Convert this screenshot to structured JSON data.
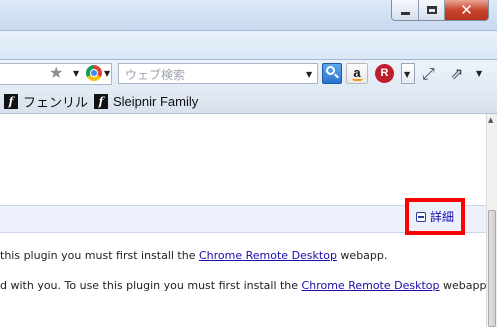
{
  "search": {
    "placeholder": "ウェブ検索"
  },
  "toolbar": {
    "amazon_label": "a",
    "rakuten_label": "R"
  },
  "bookmarks": [
    {
      "icon": "sleipnir-logo-icon",
      "label": "フェンリル"
    },
    {
      "icon": "sleipnir-logo-icon",
      "label": "Sleipnir Family"
    }
  ],
  "plugin": {
    "details_label": "詳細",
    "line1": {
      "before": "this plugin you must first install the ",
      "link": "Chrome Remote Desktop",
      "after": " webapp."
    },
    "line2": {
      "before": "d with you. To use this plugin you must first install the ",
      "link": "Chrome Remote Desktop",
      "after": " webapp."
    }
  },
  "colors": {
    "highlight": "#ff0000",
    "link": "#1a0dab",
    "rakuten": "#bf1e2d",
    "search_button": "#2a72cc"
  }
}
